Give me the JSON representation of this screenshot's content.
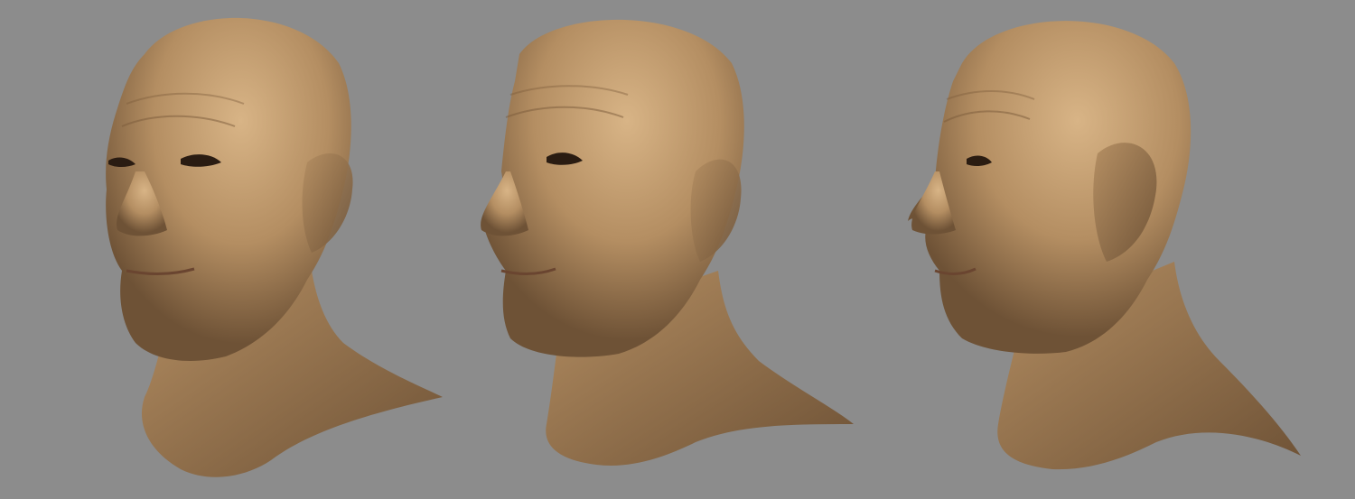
{
  "scene": {
    "background_color": "#8c8c8c",
    "skin_base": "#b48e62",
    "skin_highlight": "#d8b486",
    "skin_shadow": "#6e5236",
    "views": [
      {
        "id": "view-1",
        "icon": "bald-head-three-quarter-left-render"
      },
      {
        "id": "view-2",
        "icon": "bald-head-three-quarter-left-render"
      },
      {
        "id": "view-3",
        "icon": "bald-head-profile-left-render"
      }
    ]
  }
}
